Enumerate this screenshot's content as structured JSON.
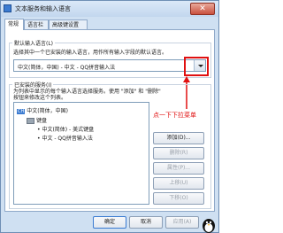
{
  "window": {
    "title": "文本服务和输入语言",
    "close_symbol": "✕",
    "icon_name": "keyboard-app-icon"
  },
  "tabs": [
    {
      "label": "常规",
      "active": true
    },
    {
      "label": "语言栏",
      "active": false
    },
    {
      "label": "高级键设置",
      "active": false
    }
  ],
  "default_language": {
    "group_title": "默认输入语言(L)",
    "description": "选择其中一个已安装的输入语言，用作所有输入字段的默认语言。",
    "selected_value": "中文(简体，中国) - 中文 - QQ拼音输入法"
  },
  "installed_services": {
    "group_title": "已安装的服务(I)",
    "description_line1": "为列表中显示的每个输入语言选择服务。使用 \"添加\" 和 \"删除\"",
    "description_line2": "按钮来修改这个列表。",
    "tree": {
      "language_badge": "CH",
      "language": "中文(简体，中国)",
      "category": "键盘",
      "items": [
        "中文(简体) - 美式键盘",
        "中文 - QQ拼音输入法"
      ]
    }
  },
  "side_buttons": [
    {
      "label": "添加(D)...",
      "enabled": true
    },
    {
      "label": "删除(R)",
      "enabled": false
    },
    {
      "label": "属性(P)...",
      "enabled": false
    },
    {
      "label": "上移(U)",
      "enabled": false
    },
    {
      "label": "下移(O)",
      "enabled": false
    }
  ],
  "annotation": {
    "text": "点一下下拉菜单",
    "color": "#e01010"
  },
  "footer": {
    "ok_label": "确定",
    "cancel_label": "取消",
    "apply_label": "应用(A)"
  },
  "colors": {
    "accent": "#3b7bd1",
    "annotation_red": "#e01010"
  }
}
